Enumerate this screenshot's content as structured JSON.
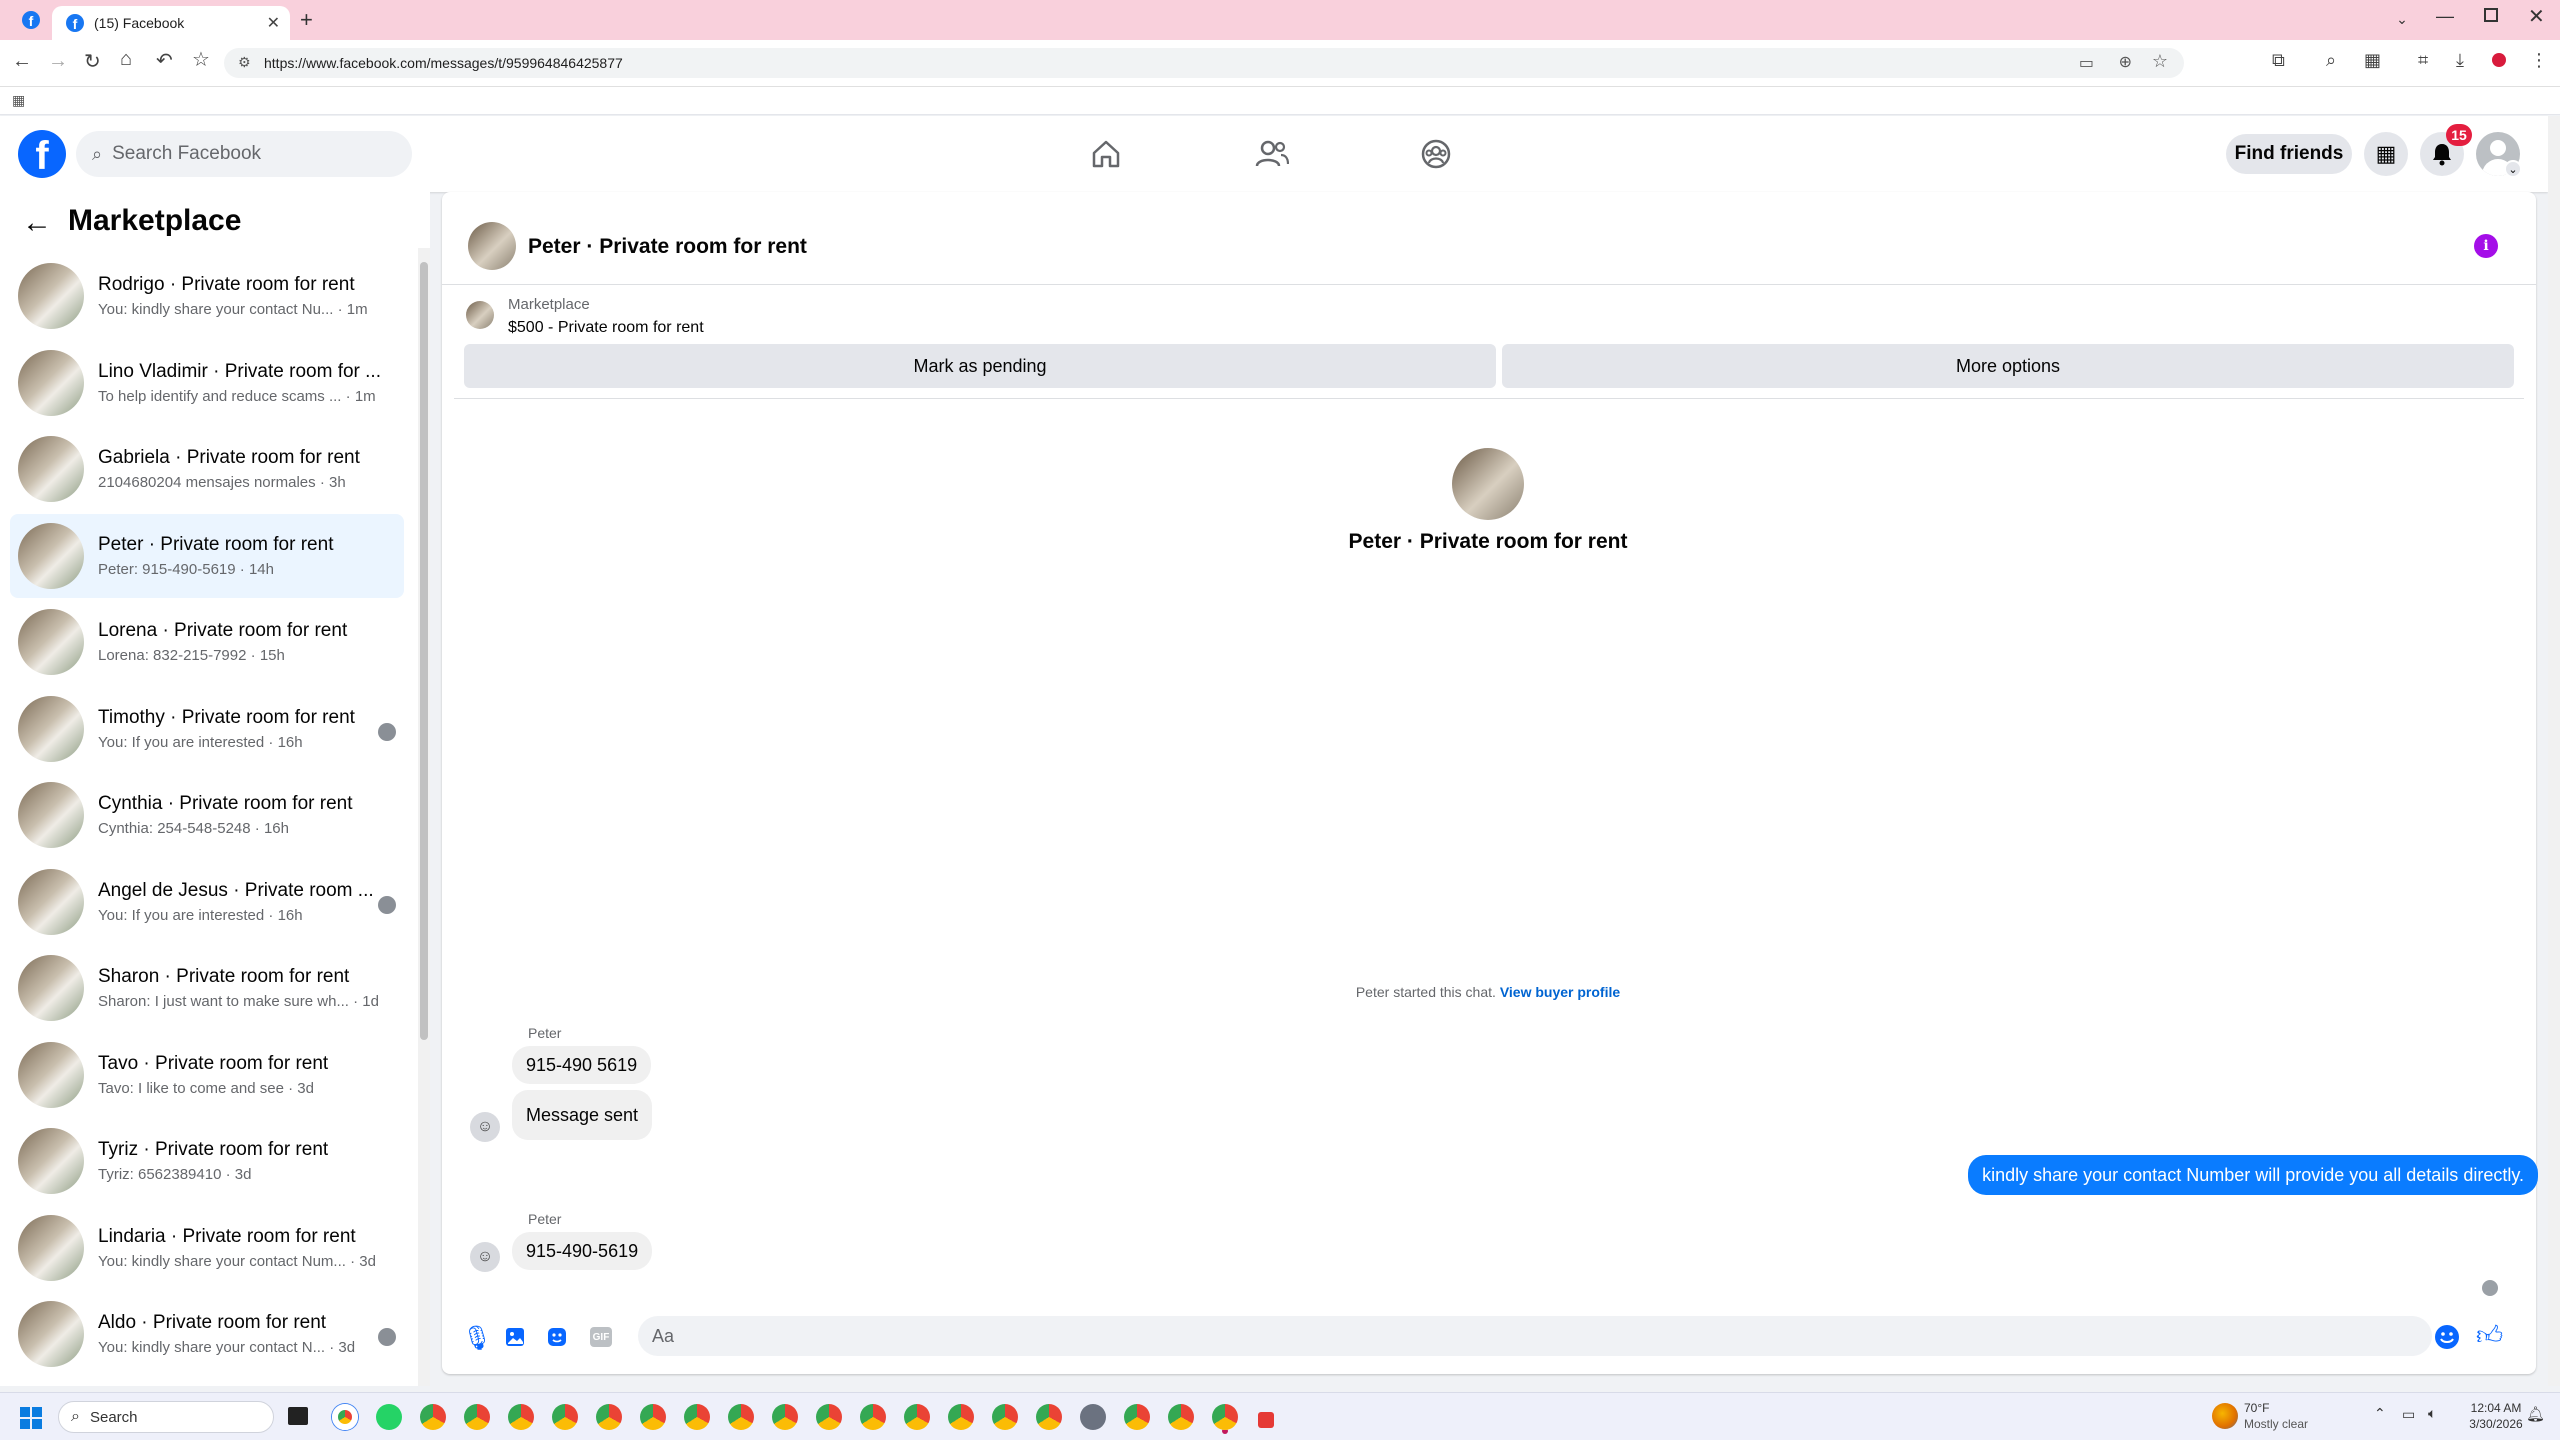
{
  "browser": {
    "tab_title": "(15) Facebook",
    "url": "https://www.facebook.com/messages/t/959964846425877"
  },
  "header": {
    "search_placeholder": "Search Facebook",
    "find_friends": "Find friends",
    "notification_count": "15"
  },
  "sidebar": {
    "title": "Marketplace",
    "conversations": [
      {
        "name": "Rodrigo · Private room for rent",
        "preview": "You: kindly share your contact Nu...",
        "time": "1m"
      },
      {
        "name": "Lino Vladimir · Private room for ...",
        "preview": "To help identify and reduce scams ...",
        "time": "1m"
      },
      {
        "name": "Gabriela · Private room for rent",
        "preview": "2104680204 mensajes normales",
        "time": "3h"
      },
      {
        "name": "Peter · Private room for rent",
        "preview": "Peter: 915-490-5619",
        "time": "14h"
      },
      {
        "name": "Lorena · Private room for rent",
        "preview": "Lorena: 832-215-7992",
        "time": "15h"
      },
      {
        "name": "Timothy · Private room for rent",
        "preview": "You: If you are interested",
        "time": "16h"
      },
      {
        "name": "Cynthia · Private room for rent",
        "preview": "Cynthia: 254-548-5248",
        "time": "16h"
      },
      {
        "name": "Angel de Jesus · Private room ...",
        "preview": "You: If you are interested",
        "time": "16h"
      },
      {
        "name": "Sharon · Private room for rent",
        "preview": "Sharon: I just want to make sure wh...",
        "time": "1d"
      },
      {
        "name": "Tavo · Private room for rent",
        "preview": "Tavo: I like to come and see",
        "time": "3d"
      },
      {
        "name": "Tyriz · Private room for rent",
        "preview": "Tyriz: 6562389410",
        "time": "3d"
      },
      {
        "name": "Lindaria · Private room for rent",
        "preview": "You: kindly share your contact Num...",
        "time": "3d"
      },
      {
        "name": "Aldo · Private room for rent",
        "preview": "You: kindly share your contact N...",
        "time": "3d"
      }
    ]
  },
  "chat": {
    "title": "Peter · Private room for rent",
    "listing_label": "Marketplace",
    "listing_price_title": "$500 - Private room for rent",
    "mark_pending": "Mark as pending",
    "more_options": "More options",
    "center_title": "Peter · Private room for rent",
    "started_text": "Peter started this chat.",
    "view_profile": "View buyer profile",
    "sender1": "Peter",
    "msg1": "915-490 5619",
    "msg2": "Message sent",
    "msg_out": "kindly share your contact Number will provide you all details directly.",
    "sender2": "Peter",
    "msg3": "915-490-5619",
    "composer_placeholder": "Aa"
  },
  "taskbar": {
    "search": "Search",
    "weather_temp": "70°F",
    "weather_desc": "Mostly clear",
    "time": "12:04 AM",
    "date": "3/30/2026"
  }
}
